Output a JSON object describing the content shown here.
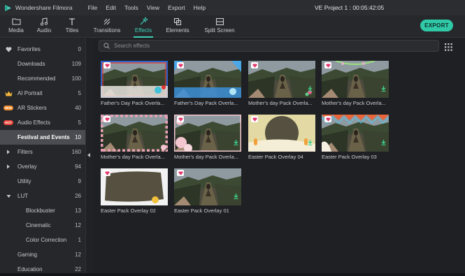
{
  "titlebar": {
    "app_name": "Wondershare Filmora",
    "menu": [
      "File",
      "Edit",
      "Tools",
      "View",
      "Export",
      "Help"
    ],
    "project": "VE Project 1 : 00:05:42:05"
  },
  "toolbar": {
    "tabs": [
      {
        "label": "Media",
        "icon": "folder-icon"
      },
      {
        "label": "Audio",
        "icon": "music-note-icon"
      },
      {
        "label": "Titles",
        "icon": "text-t-icon"
      },
      {
        "label": "Transitions",
        "icon": "transition-icon"
      },
      {
        "label": "Effects",
        "icon": "sparkle-wand-icon",
        "active": true
      },
      {
        "label": "Elements",
        "icon": "elements-icon"
      },
      {
        "label": "Split Screen",
        "icon": "split-screen-icon"
      }
    ],
    "export_label": "EXPORT",
    "accent": "#3fd0b8"
  },
  "sidebar": {
    "items": [
      {
        "label": "Favorites",
        "count": "0",
        "icon": "heart-icon"
      },
      {
        "label": "Downloads",
        "count": "109"
      },
      {
        "label": "Recommended",
        "count": "100"
      },
      {
        "label": "AI Portrait",
        "count": "5",
        "icon": "crown-icon"
      },
      {
        "label": "AR Stickers",
        "count": "40",
        "badge": "NEW"
      },
      {
        "label": "Audio Effects",
        "count": "5",
        "badge": "HOT"
      },
      {
        "label": "Festival and Events",
        "count": "10",
        "active": true
      },
      {
        "label": "Filters",
        "count": "160",
        "icon": "expand-arrow-icon"
      },
      {
        "label": "Overlay",
        "count": "94",
        "icon": "expand-arrow-icon"
      },
      {
        "label": "Utility",
        "count": "9"
      },
      {
        "label": "LUT",
        "count": "26",
        "icon": "collapse-arrow-icon"
      },
      {
        "label": "Blockbuster",
        "count": "13",
        "sub": true
      },
      {
        "label": "Cinematic",
        "count": "12",
        "sub": true
      },
      {
        "label": "Color Correction",
        "count": "1",
        "sub": true
      },
      {
        "label": "Gaming",
        "count": "12"
      },
      {
        "label": "Education",
        "count": "22"
      }
    ]
  },
  "search": {
    "placeholder": "Search effects"
  },
  "effects": [
    {
      "caption": "Father's Day Pack Overla...",
      "style": "fathers1"
    },
    {
      "caption": "Father's Day Pack Overla...",
      "style": "fathers2"
    },
    {
      "caption": "Mother's day Pack Overla...",
      "style": "mothers1"
    },
    {
      "caption": "Mother's day Pack Overla...",
      "style": "mothers2"
    },
    {
      "caption": "Mother's day Pack Overla...",
      "style": "mothers3"
    },
    {
      "caption": "Mother's day Pack Overla...",
      "style": "mothers4"
    },
    {
      "caption": "Easter Pack Overlay 04",
      "style": "easter4"
    },
    {
      "caption": "Easter Pack Overlay 03",
      "style": "easter3"
    },
    {
      "caption": "Easter Pack Overlay 02",
      "style": "easter2"
    },
    {
      "caption": "Easter Pack Overlay 01",
      "style": "easter1"
    }
  ]
}
